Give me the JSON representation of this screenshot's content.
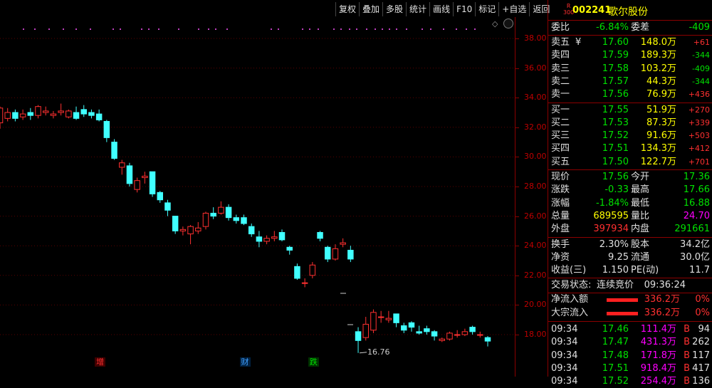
{
  "toolbar": {
    "buttons": [
      "复权",
      "叠加",
      "多股",
      "统计",
      "画线",
      "F10",
      "标记",
      "+自选",
      "返回"
    ]
  },
  "chart_data": {
    "type": "candlestick",
    "ylim": [
      16,
      39
    ],
    "yticks": [
      "38.00",
      "36.00",
      "34.00",
      "32.00",
      "30.00",
      "28.00",
      "26.00",
      "24.00",
      "22.00",
      "20.00",
      "18.00"
    ],
    "candles": [
      [
        32.3,
        33.3,
        33.4,
        31.9
      ],
      [
        32.6,
        33.0,
        33.3,
        32.4
      ],
      [
        33.0,
        32.6,
        33.2,
        32.4
      ],
      [
        32.7,
        32.9,
        33.2,
        32.5
      ],
      [
        33.0,
        32.8,
        33.3,
        32.5
      ],
      [
        32.8,
        33.4,
        33.5,
        32.6
      ],
      [
        33.0,
        33.1,
        33.4,
        32.8
      ],
      [
        32.8,
        32.9,
        33.1,
        32.6
      ],
      [
        33.0,
        33.1,
        33.6,
        32.8
      ],
      [
        32.7,
        33.1,
        33.2,
        32.6
      ],
      [
        33.0,
        32.6,
        33.4,
        32.5
      ],
      [
        33.2,
        32.9,
        33.5,
        32.7
      ],
      [
        33.0,
        32.8,
        33.2,
        32.6
      ],
      [
        32.9,
        32.5,
        33.2,
        32.4
      ],
      [
        32.4,
        31.3,
        32.5,
        31.0
      ],
      [
        31.0,
        29.9,
        31.2,
        29.8
      ],
      [
        29.3,
        29.6,
        29.8,
        28.8
      ],
      [
        29.4,
        28.2,
        29.6,
        28.0
      ],
      [
        27.8,
        28.4,
        28.6,
        27.6
      ],
      [
        28.6,
        28.7,
        29.0,
        28.2
      ],
      [
        29.0,
        27.5,
        29.0,
        27.3
      ],
      [
        27.6,
        27.1,
        27.7,
        26.9
      ],
      [
        26.9,
        26.4,
        27.1,
        26.0
      ],
      [
        26.0,
        25.0,
        26.0,
        24.8
      ],
      [
        25.0,
        25.1,
        25.3,
        24.7
      ],
      [
        24.8,
        25.3,
        25.4,
        24.1
      ],
      [
        25.0,
        25.2,
        25.6,
        24.8
      ],
      [
        25.3,
        26.2,
        26.3,
        25.1
      ],
      [
        26.2,
        26.0,
        26.6,
        25.8
      ],
      [
        26.2,
        26.6,
        27.0,
        26.1
      ],
      [
        26.6,
        25.9,
        26.8,
        25.7
      ],
      [
        25.9,
        25.7,
        26.1,
        25.5
      ],
      [
        25.9,
        25.5,
        26.1,
        25.4
      ],
      [
        25.3,
        24.8,
        25.5,
        24.6
      ],
      [
        24.6,
        24.3,
        25.0,
        23.9
      ],
      [
        24.3,
        24.5,
        24.7,
        24.1
      ],
      [
        24.5,
        24.6,
        25.0,
        24.3
      ],
      [
        24.9,
        24.4,
        25.1,
        24.3
      ],
      [
        23.9,
        23.7,
        24.0,
        23.4
      ],
      [
        22.6,
        21.8,
        22.8,
        21.7
      ],
      [
        21.5,
        21.5,
        21.8,
        21.2
      ],
      [
        22.0,
        22.7,
        22.9,
        21.8
      ],
      [
        24.9,
        24.5,
        25.0,
        24.3
      ],
      [
        23.9,
        23.1,
        24.0,
        22.9
      ],
      [
        23.1,
        23.8,
        24.1,
        23.0
      ],
      [
        24.1,
        24.2,
        24.5,
        23.9
      ],
      [
        23.7,
        23.1,
        24.0,
        22.9
      ],
      [
        18.2,
        17.6,
        18.5,
        16.76
      ],
      [
        17.8,
        18.7,
        19.2,
        17.6
      ],
      [
        18.3,
        19.5,
        19.7,
        18.1
      ],
      [
        19.2,
        19.2,
        19.6,
        18.8
      ],
      [
        19.0,
        19.1,
        19.6,
        18.8
      ],
      [
        19.4,
        18.8,
        19.4,
        18.5
      ],
      [
        18.6,
        18.3,
        18.8,
        18.1
      ],
      [
        18.8,
        18.5,
        18.9,
        18.2
      ],
      [
        18.2,
        18.1,
        18.6,
        18.0
      ],
      [
        18.4,
        18.2,
        18.6,
        18.0
      ],
      [
        18.2,
        17.9,
        18.3,
        17.6
      ],
      [
        17.6,
        17.7,
        17.8,
        17.5
      ],
      [
        17.7,
        18.1,
        18.2,
        17.6
      ],
      [
        18.0,
        18.0,
        18.3,
        17.8
      ],
      [
        18.0,
        18.2,
        18.4,
        17.9
      ],
      [
        18.5,
        18.2,
        18.6,
        18.0
      ],
      [
        18.0,
        18.0,
        18.2,
        17.8
      ],
      [
        17.8,
        17.56,
        17.9,
        17.2
      ]
    ],
    "low_label": "16.76",
    "event_tags": [
      {
        "text": "增",
        "color": "#ff3030",
        "bg": "#400000",
        "index": 13
      },
      {
        "text": "财",
        "color": "#40a0ff",
        "bg": "#002040",
        "index": 32
      },
      {
        "text": "跌",
        "color": "#00e000",
        "bg": "#003000",
        "index": 41
      }
    ]
  },
  "stock": {
    "badge_top": "R",
    "badge_bottom": "300",
    "code": "002241",
    "name": "歌尔股份"
  },
  "weibi": {
    "label1": "委比",
    "value1": "-6.84%",
    "label2": "委差",
    "value2": "-409"
  },
  "asks": [
    {
      "label": "卖五",
      "price": "17.60",
      "vol": "148.0万",
      "chg": "+61"
    },
    {
      "label": "卖四",
      "price": "17.59",
      "vol": "189.3万",
      "chg": "-344"
    },
    {
      "label": "卖三",
      "price": "17.58",
      "vol": "103.2万",
      "chg": "-409"
    },
    {
      "label": "卖二",
      "price": "17.57",
      "vol": "44.3万",
      "chg": "-344"
    },
    {
      "label": "卖一",
      "price": "17.56",
      "vol": "76.9万",
      "chg": "+436"
    }
  ],
  "yen_mark": "¥",
  "bids": [
    {
      "label": "买一",
      "price": "17.55",
      "vol": "51.9万",
      "chg": "+270"
    },
    {
      "label": "买二",
      "price": "17.53",
      "vol": "87.3万",
      "chg": "+339"
    },
    {
      "label": "买三",
      "price": "17.52",
      "vol": "91.6万",
      "chg": "+503"
    },
    {
      "label": "买四",
      "price": "17.51",
      "vol": "134.3万",
      "chg": "+412"
    },
    {
      "label": "买五",
      "price": "17.50",
      "vol": "122.7万",
      "chg": "+701"
    }
  ],
  "quote": [
    {
      "l1": "现价",
      "v1": "17.56",
      "c1": "green",
      "l2": "今开",
      "v2": "17.36",
      "c2": "green"
    },
    {
      "l1": "涨跌",
      "v1": "-0.33",
      "c1": "green",
      "l2": "最高",
      "v2": "17.66",
      "c2": "green"
    },
    {
      "l1": "涨幅",
      "v1": "-1.84%",
      "c1": "green",
      "l2": "最低",
      "v2": "16.88",
      "c2": "green"
    },
    {
      "l1": "总量",
      "v1": "689595",
      "c1": "yellow",
      "l2": "量比",
      "v2": "24.70",
      "c2": "magenta"
    },
    {
      "l1": "外盘",
      "v1": "397934",
      "c1": "red",
      "l2": "内盘",
      "v2": "291661",
      "c2": "green"
    }
  ],
  "fundamentals": [
    {
      "l1": "换手",
      "v1": "2.30%",
      "l2": "股本",
      "v2": "34.2亿"
    },
    {
      "l1": "净资",
      "v1": "9.25",
      "l2": "流通",
      "v2": "30.0亿"
    },
    {
      "l1": "收益(三)",
      "v1": "1.150",
      "l2": "PE(动)",
      "v2": "11.7"
    }
  ],
  "trade_status": {
    "label": "交易状态:",
    "value": "连续竞价",
    "time": "09:36:24"
  },
  "flows": [
    {
      "label": "净流入额",
      "value": "336.2万",
      "pct": "0%"
    },
    {
      "label": "大宗流入",
      "value": "336.2万",
      "pct": "0%"
    }
  ],
  "ticks": [
    {
      "time": "09:34",
      "price": "17.46",
      "vol": "111.4万",
      "side": "B",
      "n": "94"
    },
    {
      "time": "09:34",
      "price": "17.47",
      "vol": "431.3万",
      "side": "B",
      "n": "262"
    },
    {
      "time": "09:34",
      "price": "17.48",
      "vol": "171.8万",
      "side": "B",
      "n": "117"
    },
    {
      "time": "09:34",
      "price": "17.51",
      "vol": "918.4万",
      "side": "B",
      "n": "417"
    },
    {
      "time": "09:34",
      "price": "17.52",
      "vol": "254.4万",
      "side": "B",
      "n": "136"
    }
  ],
  "colors": {
    "up": "#ff3030",
    "down": "#40ffff",
    "axis": "#8b0000",
    "grid": "#5a0000"
  }
}
